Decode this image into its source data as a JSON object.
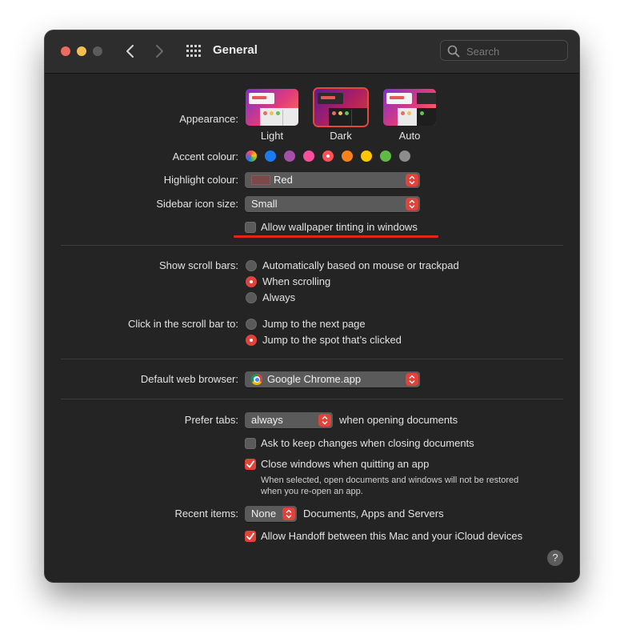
{
  "window": {
    "title": "General"
  },
  "search": {
    "placeholder": "Search"
  },
  "appearance": {
    "label": "Appearance:",
    "options": [
      {
        "label": "Light",
        "selected": false
      },
      {
        "label": "Dark",
        "selected": true
      },
      {
        "label": "Auto",
        "selected": false
      }
    ]
  },
  "accent": {
    "label": "Accent colour:",
    "selected": "red",
    "colors": [
      {
        "name": "multicolour",
        "hex": "multicolor"
      },
      {
        "name": "blue",
        "hex": "#1b7cf2"
      },
      {
        "name": "purple",
        "hex": "#a550a7"
      },
      {
        "name": "pink",
        "hex": "#f74f9e"
      },
      {
        "name": "red",
        "hex": "#ff5257"
      },
      {
        "name": "orange",
        "hex": "#f7821b"
      },
      {
        "name": "yellow",
        "hex": "#ffc600"
      },
      {
        "name": "green",
        "hex": "#62ba46"
      },
      {
        "name": "graphite",
        "hex": "#8c8c8c"
      }
    ]
  },
  "highlight": {
    "label": "Highlight colour:",
    "value": "Red",
    "swatch": "#7a4a4a"
  },
  "sidebar_icon_size": {
    "label": "Sidebar icon size:",
    "value": "Small"
  },
  "wallpaper_tinting": {
    "label": "Allow wallpaper tinting in windows",
    "checked": false
  },
  "scroll_bars": {
    "label": "Show scroll bars:",
    "options": [
      {
        "label": "Automatically based on mouse or trackpad",
        "selected": false
      },
      {
        "label": "When scrolling",
        "selected": true
      },
      {
        "label": "Always",
        "selected": false
      }
    ]
  },
  "click_scroll": {
    "label": "Click in the scroll bar to:",
    "options": [
      {
        "label": "Jump to the next page",
        "selected": false
      },
      {
        "label": "Jump to the spot that’s clicked",
        "selected": true
      }
    ]
  },
  "browser": {
    "label": "Default web browser:",
    "value": "Google Chrome.app"
  },
  "prefer_tabs": {
    "label": "Prefer tabs:",
    "value": "always",
    "suffix": "when opening documents"
  },
  "ask_keep_changes": {
    "label": "Ask to keep changes when closing documents",
    "checked": false
  },
  "close_windows": {
    "label": "Close windows when quitting an app",
    "checked": true,
    "note_line1": "When selected, open documents and windows will not be restored",
    "note_line2": "when you re-open an app."
  },
  "recent_items": {
    "label": "Recent items:",
    "value": "None",
    "suffix": "Documents, Apps and Servers"
  },
  "handoff": {
    "label": "Allow Handoff between this Mac and your iCloud devices",
    "checked": true
  },
  "help": {
    "label": "?"
  },
  "colors": {
    "accent": "#e0433a",
    "annotation_underline": "#e4241b",
    "window_bg": "#242424"
  }
}
